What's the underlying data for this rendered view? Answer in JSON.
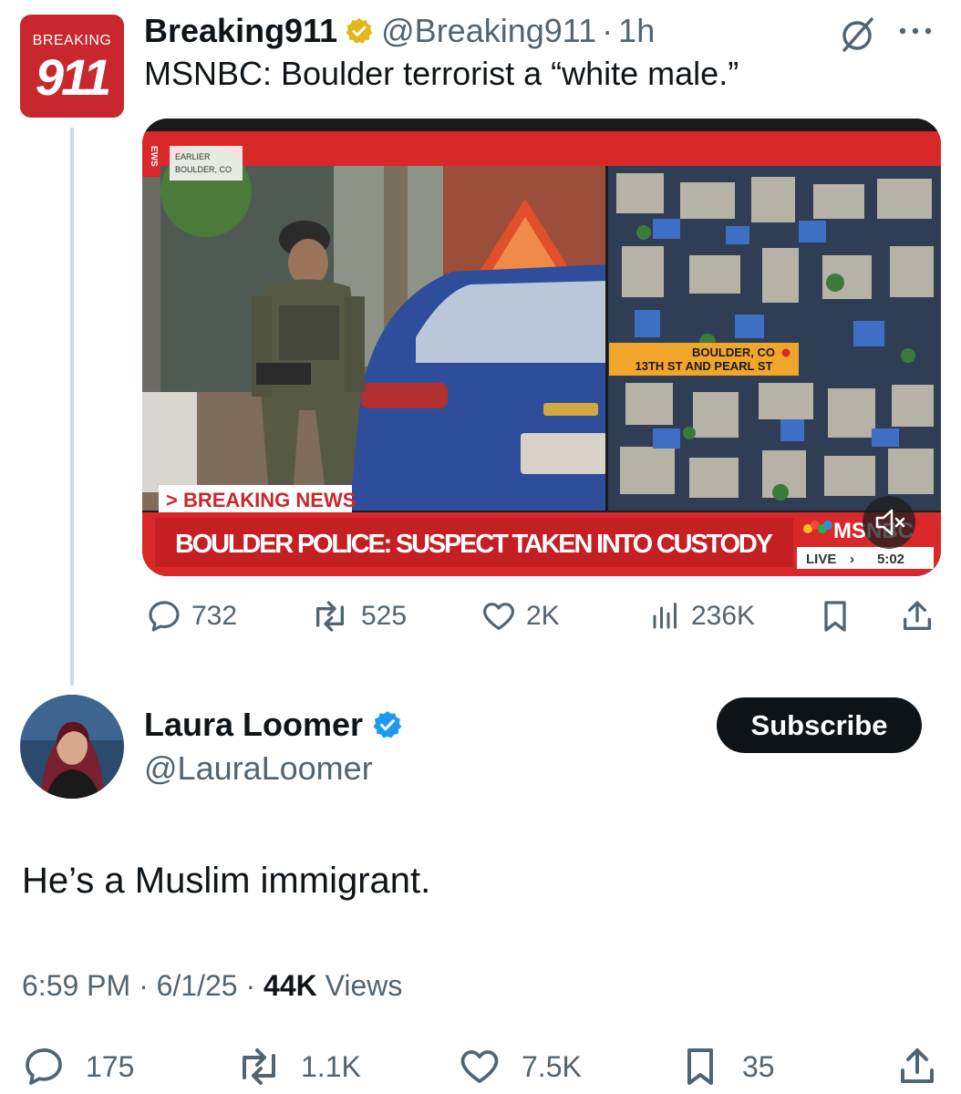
{
  "quoted_tweet": {
    "avatar": {
      "top_text": "BREAKING",
      "number": "911"
    },
    "display_name": "Breaking911",
    "verified": "gold-checkmark-icon",
    "handle": "@Breaking911",
    "separator": "·",
    "time": "1h",
    "text": "MSNBC: Boulder terrorist a “white male.”",
    "media": {
      "corner_tag_line1": "EARLIER",
      "corner_tag_line2": "BOULDER, CO",
      "map_tag_line1": "BOULDER, CO",
      "map_tag_line2": "13TH ST AND PEARL ST",
      "breaking_label": "> BREAKING NEWS",
      "headline": "BOULDER POLICE: SUSPECT TAKEN INTO CUSTODY",
      "network": "MSNBC",
      "live_label": "LIVE",
      "live_time": "5:02",
      "side_tag": "EWS",
      "mute_icon": "speaker-muted-icon"
    },
    "actions": {
      "replies": "732",
      "reposts": "525",
      "likes": "2K",
      "views": "236K"
    }
  },
  "reply_tweet": {
    "display_name": "Laura Loomer",
    "verified": "blue-checkmark-icon",
    "handle": "@LauraLoomer",
    "subscribe_label": "Subscribe",
    "text": "He’s a Muslim immigrant.",
    "time": "6:59 PM",
    "date": "6/1/25",
    "views_count": "44K",
    "views_label": "Views",
    "actions": {
      "replies": "175",
      "reposts": "1.1K",
      "likes": "7.5K",
      "bookmarks": "35"
    }
  },
  "colors": {
    "brand_red": "#c8282d",
    "text_primary": "#0f1419",
    "text_secondary": "#536471",
    "verified_blue": "#1d9bf0",
    "verified_gold": "#e2b719"
  }
}
